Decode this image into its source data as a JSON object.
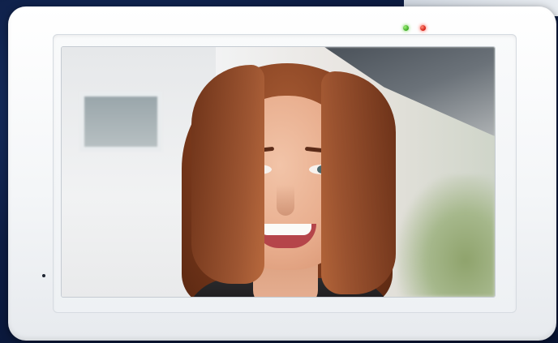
{
  "image": {
    "subject": "",
    "scene": []
  },
  "device": {
    "indicators": [
      {
        "name": "power-led",
        "color": "#48c32a"
      },
      {
        "name": "status-led",
        "color": "#e02419"
      }
    ],
    "bezel_color": "#f4f6f8",
    "background_color": "#0b1a3d"
  }
}
